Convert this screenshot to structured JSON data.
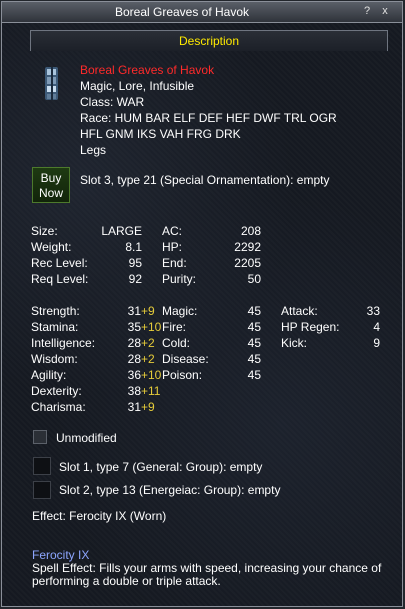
{
  "window": {
    "title": "Boreal Greaves of Havok",
    "help_glyph": "?",
    "close_glyph": "x",
    "section_header": "Description"
  },
  "item": {
    "name": "Boreal Greaves of Havok",
    "flags": "Magic, Lore, Infusible",
    "class_line": "Class: WAR",
    "race_line1": "Race: HUM BAR ELF DEF HEF DWF TRL OGR",
    "race_line2": "HFL GNM IKS VAH FRG DRK",
    "slot_type": "Legs",
    "buy_label_line1": "Buy",
    "buy_label_line2": "Now",
    "aug_slot_special": "Slot 3, type 21 (Special Ornamentation): empty",
    "icon": "greaves-icon"
  },
  "stats": {
    "size": {
      "label": "Size:",
      "value": "LARGE"
    },
    "weight": {
      "label": "Weight:",
      "value": "8.1"
    },
    "rec_level": {
      "label": "Rec Level:",
      "value": "95"
    },
    "req_level": {
      "label": "Req Level:",
      "value": "92"
    },
    "ac": {
      "label": "AC:",
      "value": "208"
    },
    "hp": {
      "label": "HP:",
      "value": "2292"
    },
    "end": {
      "label": "End:",
      "value": "2205"
    },
    "purity": {
      "label": "Purity:",
      "value": "50"
    }
  },
  "attributes": [
    {
      "label": "Strength:",
      "value": "31",
      "bonus": "+9"
    },
    {
      "label": "Stamina:",
      "value": "35",
      "bonus": "+10"
    },
    {
      "label": "Intelligence:",
      "value": "28",
      "bonus": "+2"
    },
    {
      "label": "Wisdom:",
      "value": "28",
      "bonus": "+2"
    },
    {
      "label": "Agility:",
      "value": "36",
      "bonus": "+10"
    },
    {
      "label": "Dexterity:",
      "value": "38",
      "bonus": "+11"
    },
    {
      "label": "Charisma:",
      "value": "31",
      "bonus": "+9"
    }
  ],
  "resists": [
    {
      "label": "Magic:",
      "value": "45"
    },
    {
      "label": "Fire:",
      "value": "45"
    },
    {
      "label": "Cold:",
      "value": "45"
    },
    {
      "label": "Disease:",
      "value": "45"
    },
    {
      "label": "Poison:",
      "value": "45"
    }
  ],
  "mods": [
    {
      "label": "Attack:",
      "value": "33"
    },
    {
      "label": "HP Regen:",
      "value": "4"
    },
    {
      "label": "Kick:",
      "value": "9"
    }
  ],
  "unmodified_label": "Unmodified",
  "aug_slots": [
    {
      "text": "Slot 1, type 7 (General: Group): empty"
    },
    {
      "text": "Slot 2, type 13 (Energeiac: Group): empty"
    }
  ],
  "effect_line": "Effect: Ferocity IX (Worn)",
  "spell": {
    "name": "Ferocity IX",
    "desc_line1": "Spell Effect: Fills your arms with speed, increasing your chance of",
    "desc_line2": "performing a double or triple attack."
  },
  "colors": {
    "item_name": "#ff2a2a",
    "header": "#ffea00",
    "bonus": "#e6cc3a",
    "spell_name": "#8da6ff"
  }
}
